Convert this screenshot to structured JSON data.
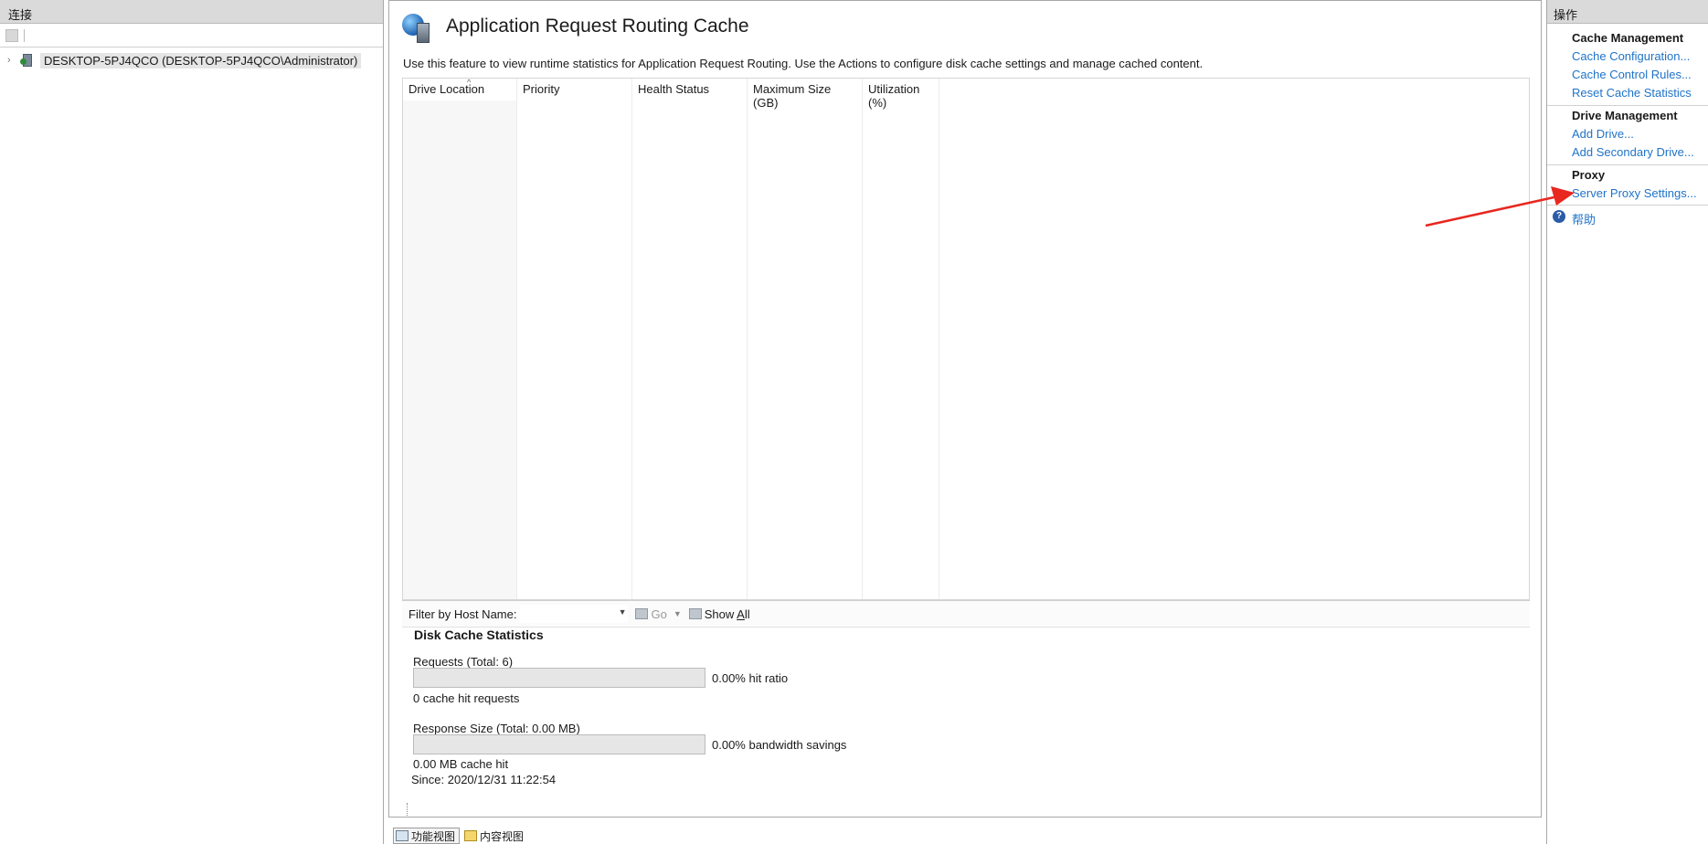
{
  "connections": {
    "header": "连接",
    "tree_item": "DESKTOP-5PJ4QCO (DESKTOP-5PJ4QCO\\Administrator)"
  },
  "main": {
    "title": "Application Request Routing Cache",
    "description": "Use this feature to view runtime statistics for Application Request Routing.  Use the Actions to configure disk cache settings and manage cached content.",
    "columns": [
      "Drive Location",
      "Priority",
      "Health Status",
      "Maximum Size (GB)",
      "Utilization (%)"
    ],
    "filter": {
      "label": "Filter by Host Name:",
      "value": "",
      "go_label": "Go",
      "show_all_prefix": "Show ",
      "show_all_accel": "A",
      "show_all_suffix": "ll"
    },
    "stats": {
      "title": "Disk Cache Statistics",
      "requests_label": "Requests (Total: 6)",
      "hit_ratio_text": "0.00% hit ratio",
      "hit_ratio_fraction": 0.0,
      "cache_hit_requests": "0 cache hit requests",
      "response_size_label": "Response Size (Total: 0.00 MB)",
      "bandwidth_text": "0.00% bandwidth savings",
      "bandwidth_fraction": 0.0,
      "mb_cache_hit": "0.00 MB cache hit",
      "since": "Since: 2020/12/31 11:22:54"
    }
  },
  "tabs": {
    "features_view": "功能视图",
    "content_view": "内容视图"
  },
  "actions": {
    "header": "操作",
    "cache_management": "Cache Management",
    "cache_configuration": "Cache Configuration...",
    "cache_control_rules": "Cache Control Rules...",
    "reset_cache_statistics": "Reset Cache Statistics",
    "drive_management": "Drive Management",
    "add_drive": "Add Drive...",
    "add_secondary_drive": "Add Secondary Drive...",
    "proxy": "Proxy",
    "server_proxy_settings": "Server Proxy Settings...",
    "help": "帮助"
  },
  "colors": {
    "link": "#1f73c8",
    "arrow": "#e8271f",
    "pane_header": "#dadada"
  }
}
